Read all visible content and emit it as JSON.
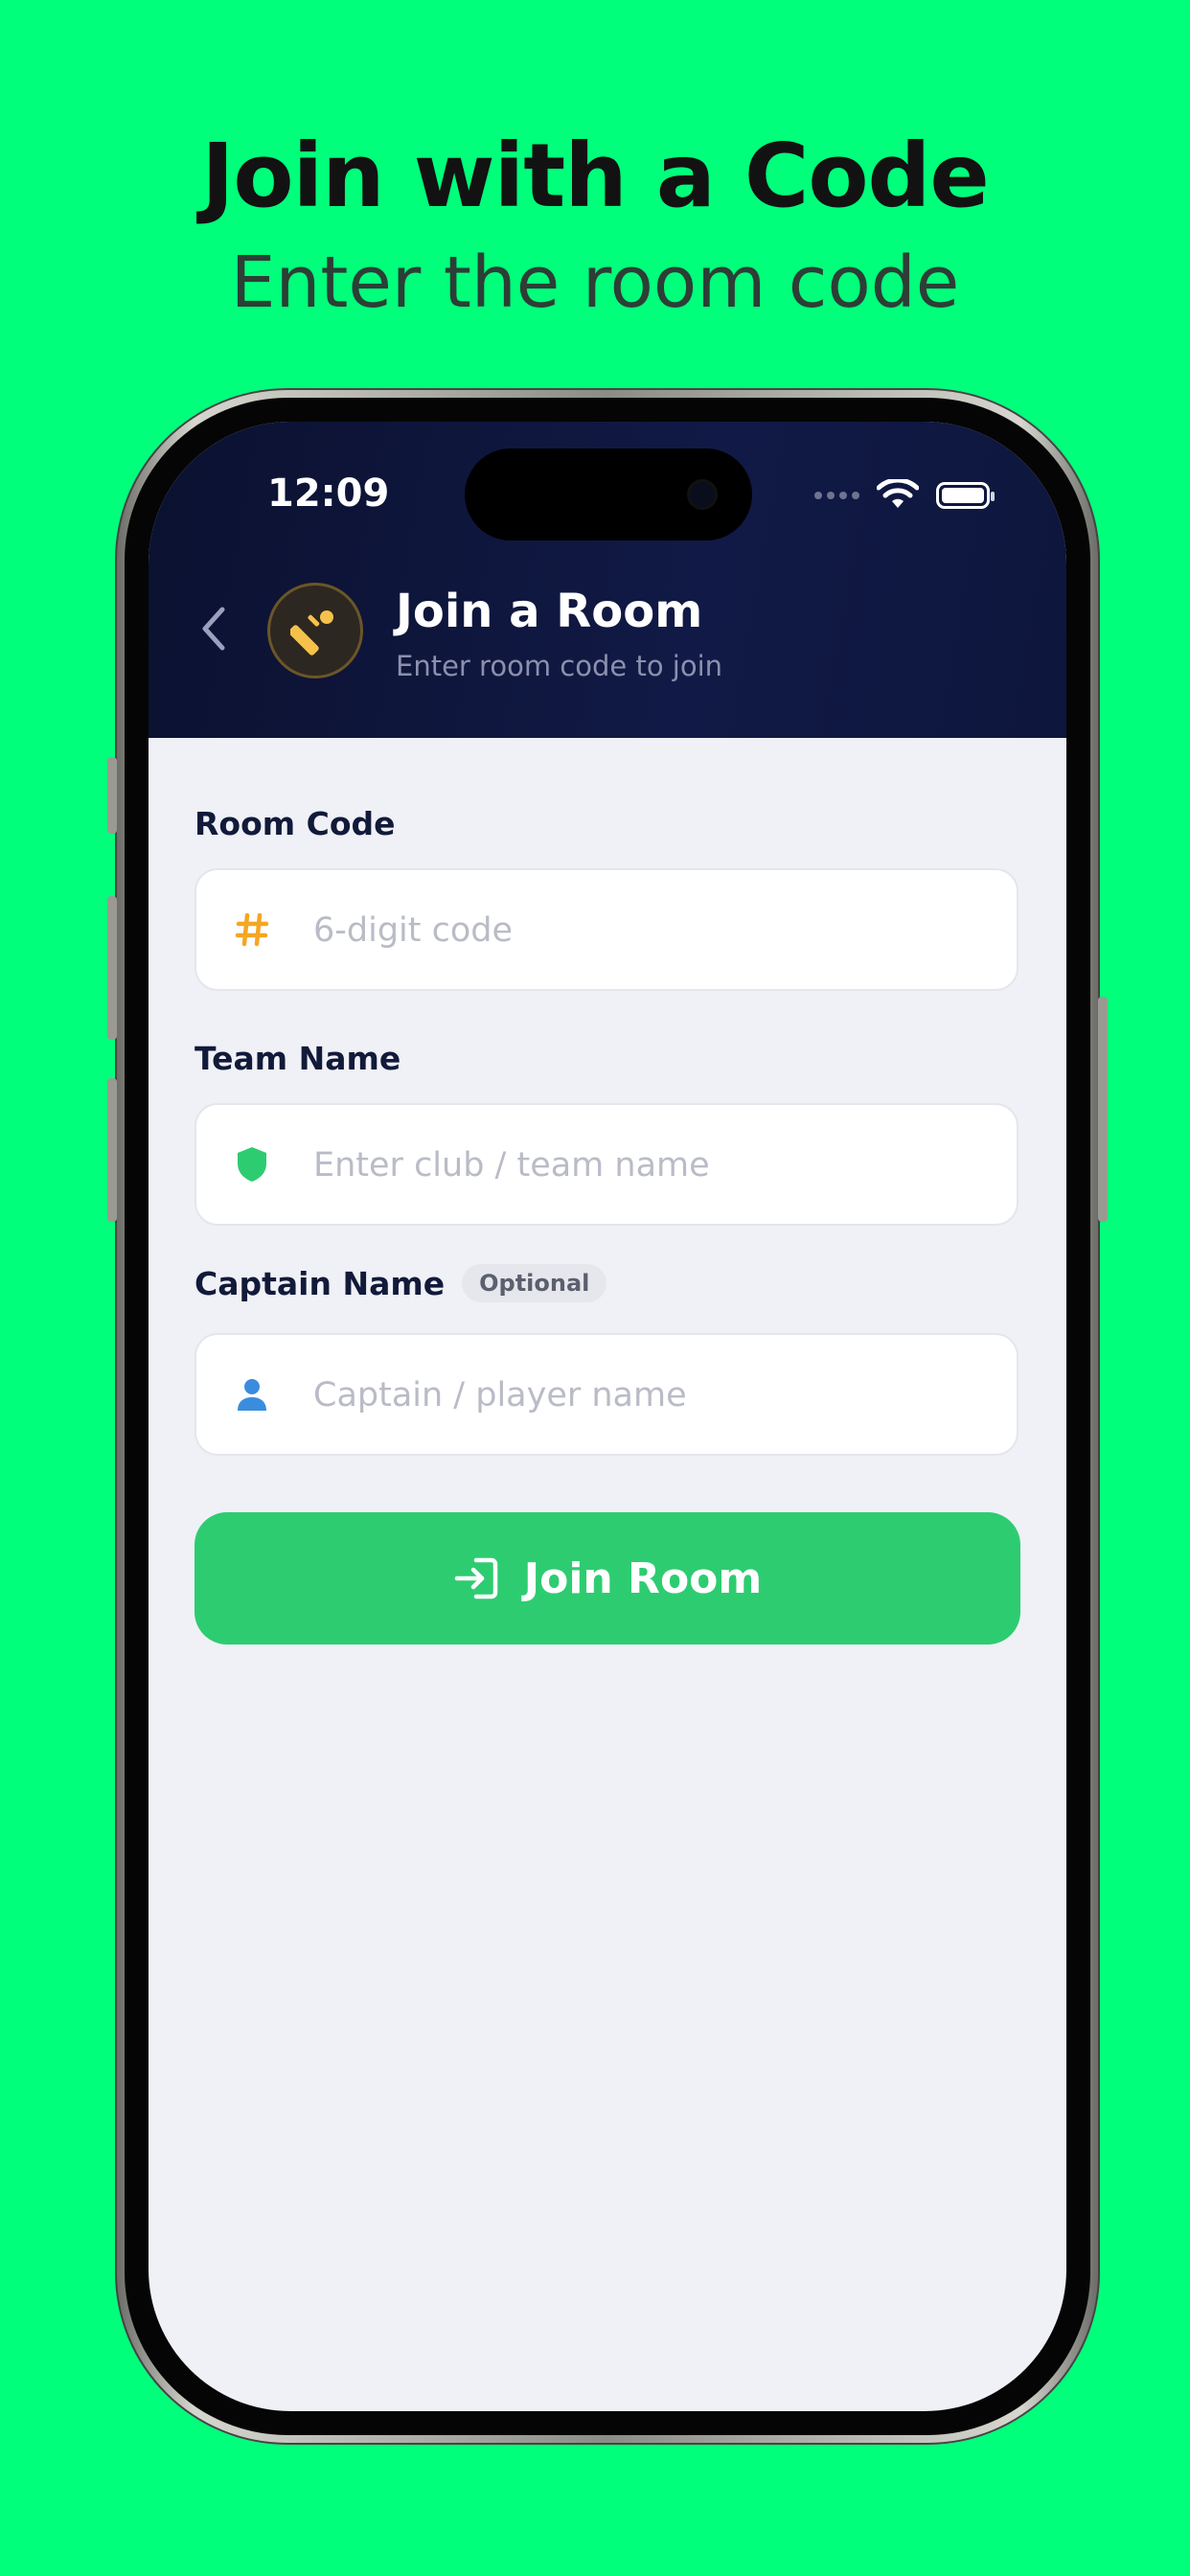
{
  "promo": {
    "headline": "Join with a Code",
    "subheadline": "Enter the room code"
  },
  "status_bar": {
    "time": "12:09"
  },
  "header": {
    "title": "Join a Room",
    "subtitle": "Enter room code to join",
    "avatar_icon": "cricket-bat-icon",
    "back_icon": "chevron-left-icon"
  },
  "form": {
    "room_code": {
      "label": "Room Code",
      "value": "",
      "placeholder": "6-digit code",
      "icon": "hash-icon",
      "icon_color": "#F5A623"
    },
    "team_name": {
      "label": "Team Name",
      "value": "",
      "placeholder": "Enter club / team name",
      "icon": "shield-icon",
      "icon_color": "#2ECC71"
    },
    "captain_name": {
      "label": "Captain Name",
      "badge": "Optional",
      "value": "",
      "placeholder": "Captain / player name",
      "icon": "person-icon",
      "icon_color": "#3A8DDE"
    },
    "submit": {
      "label": "Join Room",
      "icon": "login-arrow-icon",
      "color": "#2ECC71"
    }
  },
  "colors": {
    "background": "#00FF7B",
    "header_bg": "#0E1640",
    "screen_bg": "#F0F1F6"
  }
}
